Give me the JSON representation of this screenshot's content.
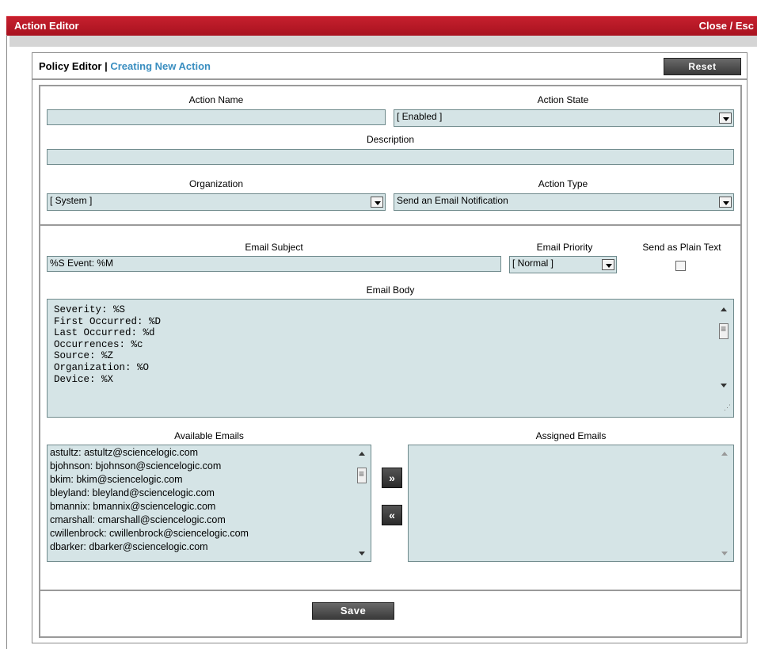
{
  "window": {
    "title": "Action Editor",
    "close_label": "Close / Esc"
  },
  "header": {
    "crumb_main": "Policy Editor | ",
    "crumb_sub": "Creating New Action",
    "reset_label": "Reset"
  },
  "form": {
    "action_name": {
      "label": "Action Name",
      "value": ""
    },
    "action_state": {
      "label": "Action State",
      "value": "[ Enabled ]"
    },
    "description": {
      "label": "Description",
      "value": ""
    },
    "organization": {
      "label": "Organization",
      "value": "[ System ]"
    },
    "action_type": {
      "label": "Action Type",
      "value": "Send an Email Notification"
    },
    "email_subject": {
      "label": "Email Subject",
      "value": "%S Event: %M"
    },
    "email_priority": {
      "label": "Email Priority",
      "value": "[ Normal ]"
    },
    "plain_text": {
      "label": "Send as Plain Text",
      "checked": false
    },
    "email_body": {
      "label": "Email Body",
      "value": "Severity: %S\nFirst Occurred: %D\nLast Occurred: %d\nOccurrences: %c\nSource: %Z\nOrganization: %O\nDevice: %X"
    },
    "available_emails": {
      "label": "Available Emails",
      "items": [
        "astultz: astultz@sciencelogic.com",
        "bjohnson: bjohnson@sciencelogic.com",
        "bkim: bkim@sciencelogic.com",
        "bleyland: bleyland@sciencelogic.com",
        "bmannix: bmannix@sciencelogic.com",
        "cmarshall: cmarshall@sciencelogic.com",
        "cwillenbrock: cwillenbrock@sciencelogic.com",
        "dbarker: dbarker@sciencelogic.com"
      ]
    },
    "assigned_emails": {
      "label": "Assigned Emails",
      "items": []
    },
    "add_label": "»",
    "remove_label": "«",
    "save_label": "Save"
  }
}
